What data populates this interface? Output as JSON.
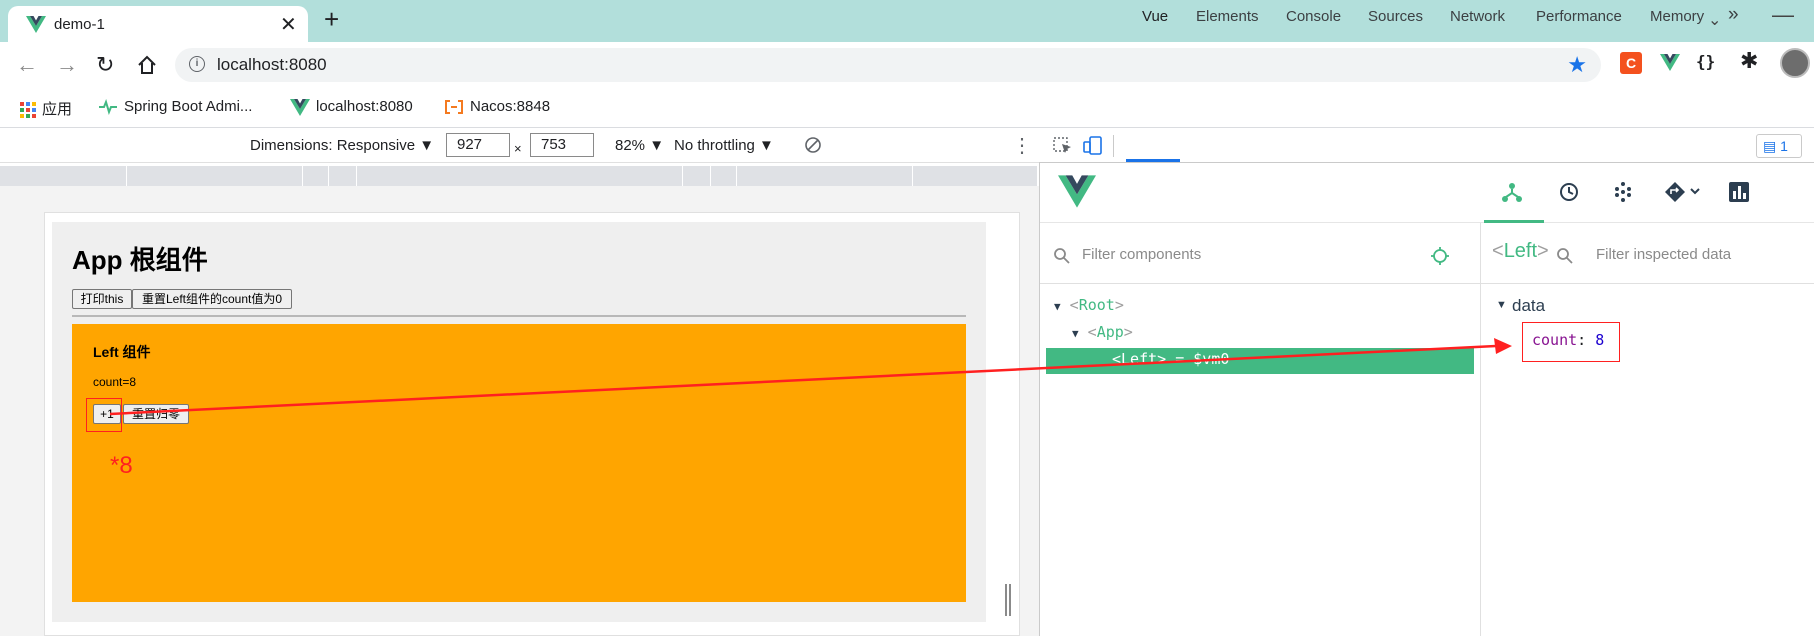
{
  "tab": {
    "title": "demo-1"
  },
  "address": {
    "url": "localhost:8080"
  },
  "bookmarks": [
    {
      "label": "应用",
      "icon": "apps-grid-icon"
    },
    {
      "label": "Spring Boot Admi...",
      "icon": "heartbeat-icon"
    },
    {
      "label": "localhost:8080",
      "icon": "vue-logo-icon"
    },
    {
      "label": "Nacos:8848",
      "icon": "nacos-icon"
    }
  ],
  "device_toolbar": {
    "dimensions": "Dimensions: Responsive ▼",
    "width": "927",
    "times": "×",
    "height": "753",
    "zoom": "82% ▼",
    "throttle": "No throttling ▼"
  },
  "page": {
    "title": "App 根组件",
    "print_button": "打印this",
    "reset_button": "重置Left组件的count值为0",
    "left_title": "Left 组件",
    "count_text": "count=8",
    "plus_button": "+1",
    "zero_button": "重置归零",
    "annotation": "*8"
  },
  "devtools": {
    "tabs": [
      "Vue",
      "Elements",
      "Console",
      "Sources",
      "Network",
      "Performance",
      "Memory"
    ],
    "more": "»",
    "issues": "1",
    "filter_components": "Filter components",
    "filter_inspected": "Filter inspected data",
    "tree": {
      "root": "Root",
      "app": "App",
      "left_row": "<Left> = $vm0"
    },
    "inspected_open": "<",
    "inspected_name": "Left",
    "inspected_close": ">",
    "data_label": "data",
    "count_key": "count",
    "count_sep": ": ",
    "count_value": "8"
  },
  "colors": {
    "tab_strip": "#b2dfdb",
    "vue_green": "#42b983",
    "left_box": "#ffa500",
    "annotation_red": "#ff2020"
  }
}
